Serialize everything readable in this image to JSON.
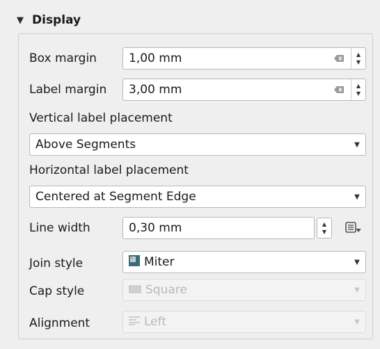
{
  "section": {
    "title": "Display"
  },
  "box_margin": {
    "label": "Box margin",
    "value": "1,00 mm"
  },
  "label_margin": {
    "label": "Label margin",
    "value": "3,00 mm"
  },
  "vertical_placement": {
    "label": "Vertical label placement",
    "value": "Above Segments"
  },
  "horizontal_placement": {
    "label": "Horizontal label placement",
    "value": "Centered at Segment Edge"
  },
  "line_width": {
    "label": "Line width",
    "value": "0,30 mm"
  },
  "join_style": {
    "label": "Join style",
    "value": "Miter"
  },
  "cap_style": {
    "label": "Cap style",
    "value": "Square"
  },
  "alignment": {
    "label": "Alignment",
    "value": "Left"
  }
}
